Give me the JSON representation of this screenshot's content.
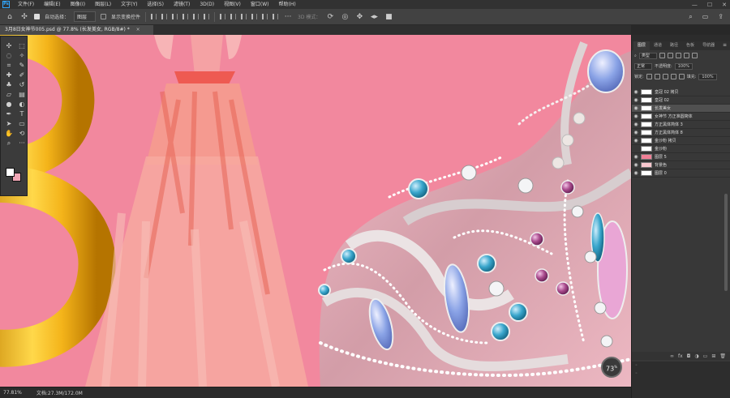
{
  "app": {
    "menu": [
      "文件(F)",
      "编辑(E)",
      "图像(I)",
      "图层(L)",
      "文字(Y)",
      "选择(S)",
      "滤镜(T)",
      "3D(D)",
      "视图(V)",
      "窗口(W)",
      "帮助(H)"
    ],
    "logo": "Ps",
    "window_controls": [
      "—",
      "☐",
      "✕"
    ]
  },
  "options_bar": {
    "auto_select_label": "自动选择：",
    "auto_select_value": "图层",
    "show_transform_label": "显示变换控件",
    "mode_3d_label": "3D 模式："
  },
  "document": {
    "tab_title": "3月8日女神节005.psd @ 77.8% (长发美女, RGB/8#) *",
    "close_glyph": "×"
  },
  "status": {
    "zoom": "77.81%",
    "doc_size": "文档:27.3M/172.0M",
    "zoom_badge": "73",
    "zoom_badge_unit": "%"
  },
  "layers_panel": {
    "tabs": [
      "图层",
      "通道",
      "路径",
      "色板",
      "导航器"
    ],
    "filter_label": "类型",
    "blend_mode": "正常",
    "opacity_label": "不透明度:",
    "opacity_value": "100%",
    "lock_label": "锁定:",
    "fill_label": "填充:",
    "fill_value": "100%",
    "layers": [
      {
        "name": "皇冠 02 拷贝",
        "visible": true,
        "selected": false,
        "thumb": "#ffffff"
      },
      {
        "name": "皇冠 02",
        "visible": true,
        "selected": false,
        "thumb": "#ffffff"
      },
      {
        "name": "长发美女",
        "visible": true,
        "selected": true,
        "thumb": "#ffffff"
      },
      {
        "name": "女神节 方正准圆简体",
        "visible": true,
        "selected": false,
        "thumb": "#ffffff"
      },
      {
        "name": "方正黑体简体 3",
        "visible": true,
        "selected": false,
        "thumb": "#ffffff"
      },
      {
        "name": "方正黑体简体 8",
        "visible": true,
        "selected": false,
        "thumb": "#ffffff"
      },
      {
        "name": "金沙粉 拷贝",
        "visible": true,
        "selected": false,
        "thumb": "#ffffff"
      },
      {
        "name": "金沙粉",
        "visible": false,
        "selected": false,
        "thumb": "#ffffff"
      },
      {
        "name": "图层 5",
        "visible": true,
        "selected": false,
        "thumb": "#f07f96"
      },
      {
        "name": "背景色",
        "visible": true,
        "selected": false,
        "thumb": "#f9c8cf"
      },
      {
        "name": "图层 0",
        "visible": true,
        "selected": false,
        "thumb": "#ffffff"
      }
    ]
  },
  "colors": {
    "canvas_pink": "#f2889e",
    "gold": "#f0b51e",
    "foreground": "#ffffff",
    "background": "#f0a6b5"
  }
}
